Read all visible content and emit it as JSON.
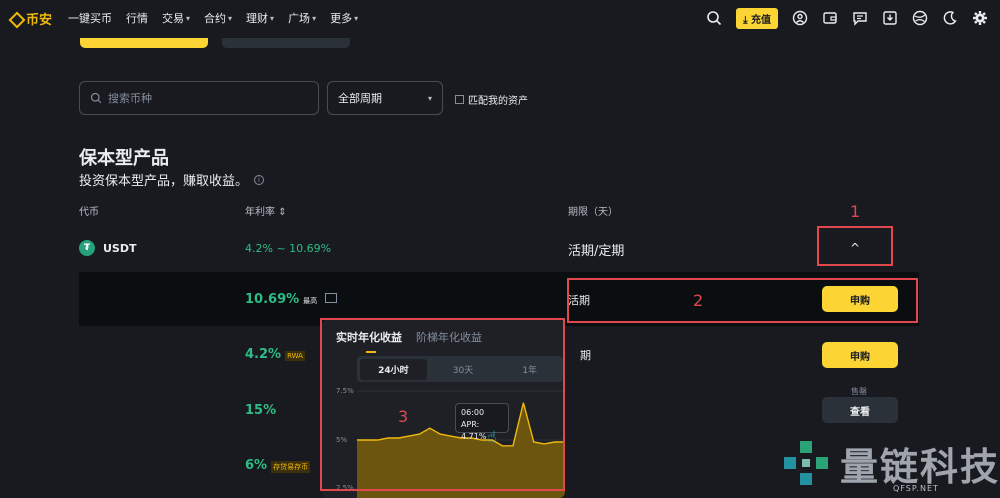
{
  "header": {
    "logo": "币安",
    "nav": [
      {
        "label": "一键买币",
        "dropdown": false
      },
      {
        "label": "行情",
        "dropdown": false
      },
      {
        "label": "交易",
        "dropdown": true
      },
      {
        "label": "合约",
        "dropdown": true
      },
      {
        "label": "理财",
        "dropdown": true
      },
      {
        "label": "广场",
        "dropdown": true
      },
      {
        "label": "更多",
        "dropdown": true
      }
    ],
    "deposit_label": "充值"
  },
  "filters": {
    "search_placeholder": "搜索币种",
    "period_value": "全部周期",
    "match_label": "匹配我的资产"
  },
  "section": {
    "title": "保本型产品",
    "subtitle": "投资保本型产品，赚取收益。"
  },
  "table": {
    "headers": {
      "coin": "代币",
      "apr": "年利率",
      "duration": "期限（天）"
    },
    "coin": "USDT",
    "apr_range": "4.2% ~ 10.69%",
    "duration": "活期/定期",
    "rows": [
      {
        "apr": "10.69%",
        "tag": "最高",
        "duration": "活期",
        "action": "申购"
      },
      {
        "apr": "4.2%",
        "tag": "RWA",
        "duration": "期",
        "action": "申购"
      },
      {
        "apr": "15%",
        "tag": "",
        "status": "售罄",
        "action": "查看"
      },
      {
        "apr": "6%",
        "tag": "存贷易存币"
      }
    ]
  },
  "popup": {
    "tabs": [
      "实时年化收益",
      "阶梯年化收益"
    ],
    "ranges": [
      "24小时",
      "30天",
      "1年"
    ],
    "selected_range": "24小时",
    "tooltip_time": "06:00",
    "tooltip_value": "APR: 4.71%",
    "chart_data": {
      "type": "area",
      "y_ticks": [
        "7.5%",
        "5%",
        "2.5%"
      ],
      "ylim": [
        2.5,
        7.5
      ],
      "values": [
        5.0,
        5.0,
        5.0,
        5.1,
        5.1,
        5.2,
        5.3,
        5.6,
        5.3,
        5.2,
        5.1,
        5.1,
        5.0,
        5.0,
        4.7,
        4.71,
        6.9,
        4.9,
        4.8,
        4.9,
        4.9
      ],
      "color": "#f0b90b"
    }
  },
  "annotations": {
    "box1": "1",
    "box2": "2",
    "box3": "3"
  },
  "watermark": {
    "text": "量链科技",
    "url": "QFSP.NET"
  }
}
